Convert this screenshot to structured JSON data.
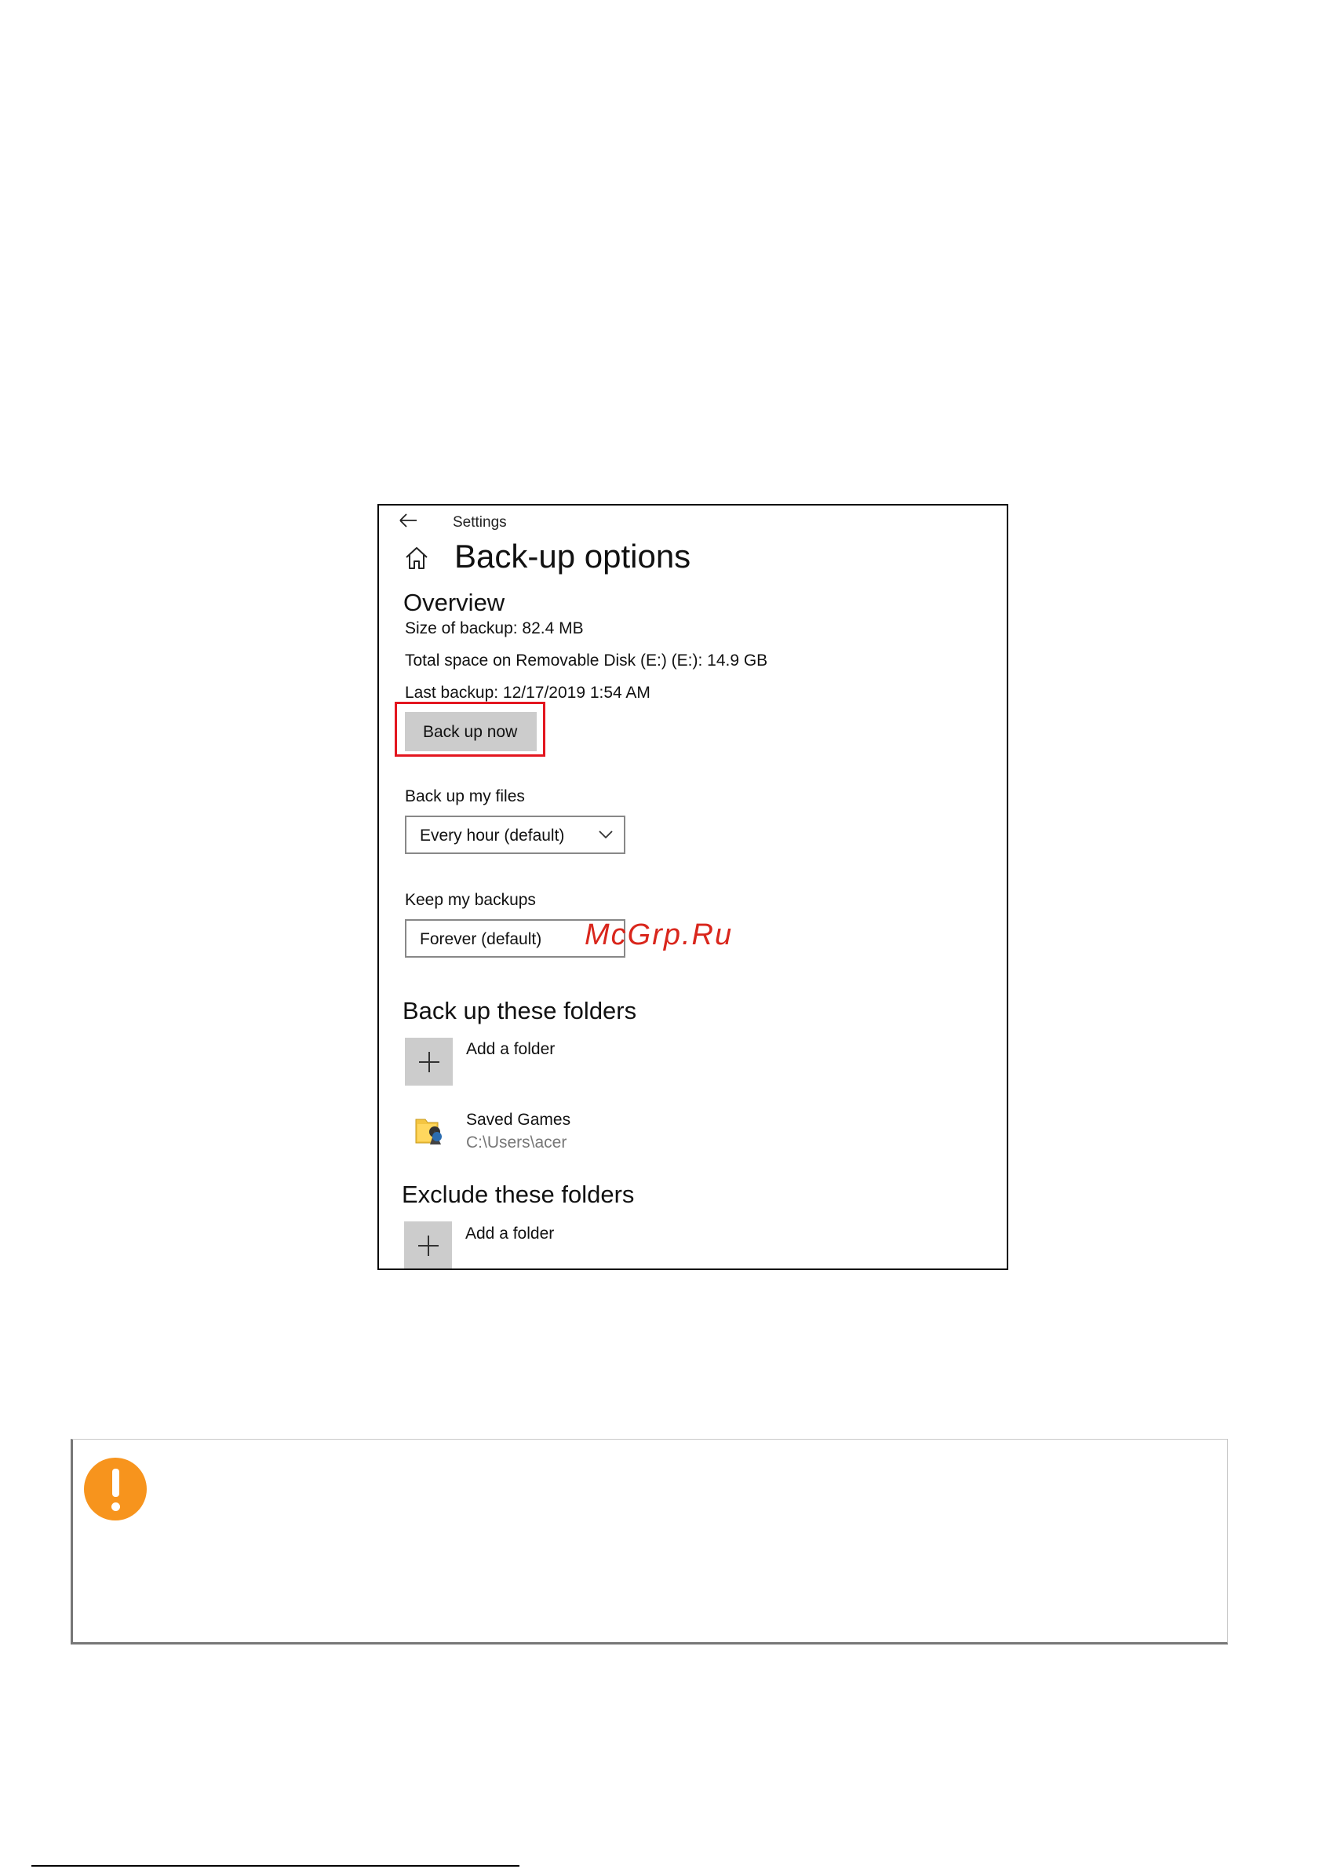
{
  "window": {
    "title": "Settings",
    "page_title": "Back-up options"
  },
  "overview": {
    "heading": "Overview",
    "size_of_backup": "Size of backup: 82.4 MB",
    "total_space": "Total space on Removable Disk (E:) (E:): 14.9 GB",
    "last_backup": "Last backup: 12/17/2019 1:54 AM",
    "back_up_now_label": "Back up now"
  },
  "frequency": {
    "label": "Back up my files",
    "selected": "Every hour (default)"
  },
  "retention": {
    "label": "Keep my backups",
    "selected": "Forever (default)"
  },
  "include_folders": {
    "heading": "Back up these folders",
    "add_label": "Add a folder",
    "items": [
      {
        "name": "Saved Games",
        "path": "C:\\Users\\acer"
      }
    ]
  },
  "exclude_folders": {
    "heading": "Exclude these folders",
    "add_label": "Add a folder"
  },
  "watermark": "McGrp.Ru",
  "colors": {
    "highlight": "#e3161f",
    "warning": "#f7941d",
    "button_gray": "#cccccc"
  }
}
